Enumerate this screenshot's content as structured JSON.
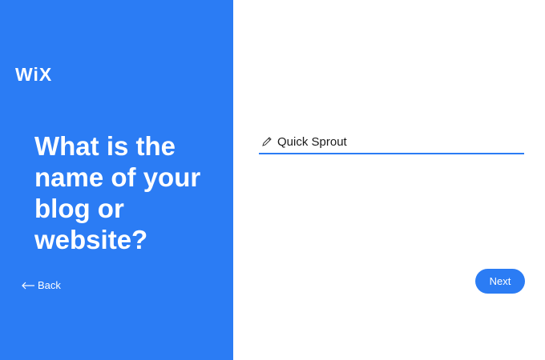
{
  "brand": {
    "logo_text": "WiX",
    "accent_color": "#2b7cf4"
  },
  "left_panel": {
    "heading": "What is the name of your blog or website?",
    "back_label": "Back",
    "back_icon": "arrow-left-icon"
  },
  "form": {
    "name_value": "Quick Sprout",
    "field_icon": "pencil-icon"
  },
  "actions": {
    "next_label": "Next"
  }
}
